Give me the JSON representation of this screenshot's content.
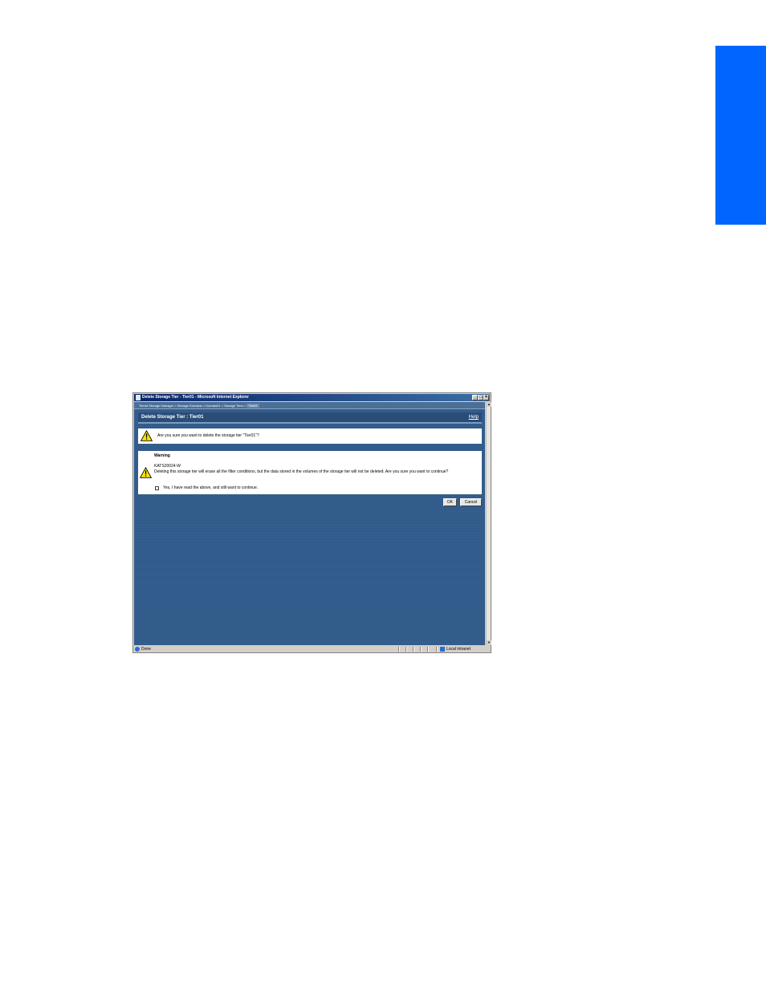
{
  "window": {
    "title": "Delete Storage Tier - Tier01 - Microsoft Internet Explorer",
    "controls": [
      "_",
      "□",
      "×"
    ]
  },
  "breadcrumb": {
    "items": [
      "Tiered Storage Manager",
      "Storage Domains",
      "Domain01",
      "Storage Tiers"
    ],
    "separator": " > ",
    "current": "Tier01"
  },
  "page": {
    "title": "Delete Storage Tier : Tier01",
    "help_label": "Help"
  },
  "confirm": {
    "message": "Are you sure you want to delete the storage tier \"Tier01\"?"
  },
  "warning": {
    "title": "Warning",
    "code": "KATS20024-W",
    "message": "Deleting this storage tier will erase all the filter conditions, but the data stored in the volumes of the storage tier will not be deleted. Are you sure you want to continue?",
    "checkbox_label": "Yes, I have read the above, and still want to continue.",
    "checkbox_checked": false
  },
  "buttons": {
    "ok": "OK",
    "cancel": "Cancel"
  },
  "status": {
    "text": "Done",
    "zone": "Local intranet"
  },
  "colors": {
    "side_tab": "#0066ff",
    "content_bg": "#35608f",
    "titlebar": "#0a246a"
  }
}
